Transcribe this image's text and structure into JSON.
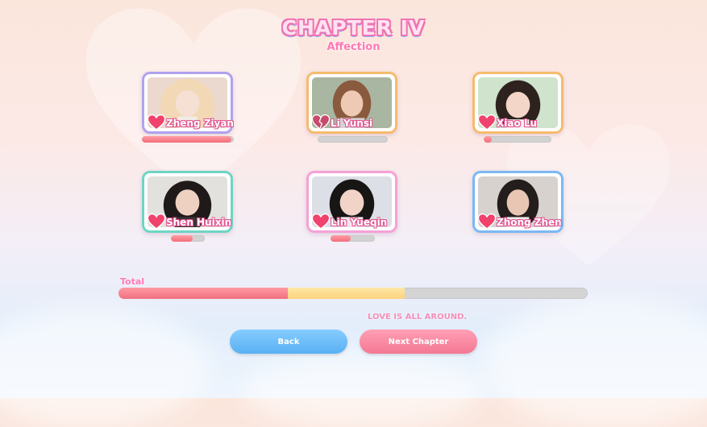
{
  "header": {
    "title": "CHAPTER IV",
    "subtitle": "Affection"
  },
  "characters": [
    {
      "name": "Zheng Ziyan",
      "affection": 0.97,
      "heart": "heart-full-icon",
      "frame_color": "#b0a2ef"
    },
    {
      "name": "Li Yunsi",
      "affection": 0.0,
      "heart": "broken-heart-icon",
      "frame_color": "#f6bb6e"
    },
    {
      "name": "Xiao Lu",
      "affection": 0.12,
      "heart": "heart-full-icon",
      "frame_color": "#f6bb6e"
    },
    {
      "name": "Shen Huixin",
      "affection": 0.65,
      "heart": "heart-full-icon",
      "frame_color": "#6ed5c3"
    },
    {
      "name": "Lin Yueqin",
      "affection": 0.45,
      "heart": "heart-full-icon",
      "frame_color": "#f6a1d6"
    },
    {
      "name": "Zhong Zhen",
      "affection": 0.0,
      "heart": "heart-full-icon",
      "frame_color": "#7cb8f4"
    }
  ],
  "total": {
    "label": "Total",
    "primary": 0.36,
    "secondary": 0.25
  },
  "tagline": "LOVE IS ALL AROUND.",
  "buttons": {
    "back": "Back",
    "next": "Next Chapter"
  },
  "colors": {
    "accent_pink": "#ff79b3",
    "affection_red": "#f26f7d",
    "secondary_yellow": "#fbd27f",
    "back_blue": "#58b0f3",
    "next_pink": "#f47893"
  }
}
